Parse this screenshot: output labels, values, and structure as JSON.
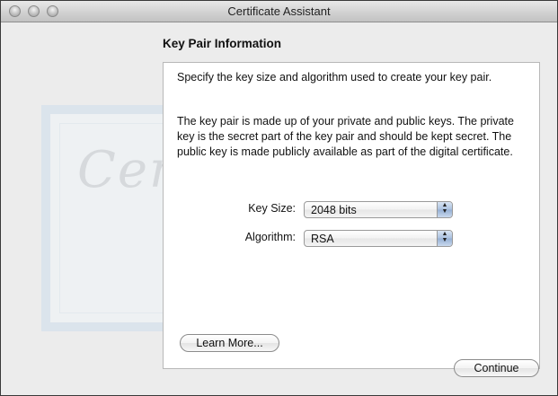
{
  "window": {
    "title": "Certificate Assistant"
  },
  "section": {
    "title": "Key Pair Information"
  },
  "panel": {
    "intro": "Specify the key size and algorithm used to create your key pair.",
    "description": "The key pair is made up of your private and public keys. The private key is the secret part of the key pair and should be kept secret. The public key is made publicly available as part of the digital certificate.",
    "key_size": {
      "label": "Key Size:",
      "value": "2048 bits"
    },
    "algorithm": {
      "label": "Algorithm:",
      "value": "RSA"
    },
    "learn_more_label": "Learn More..."
  },
  "footer": {
    "continue_label": "Continue"
  },
  "watermark": {
    "text": "Certificate"
  }
}
